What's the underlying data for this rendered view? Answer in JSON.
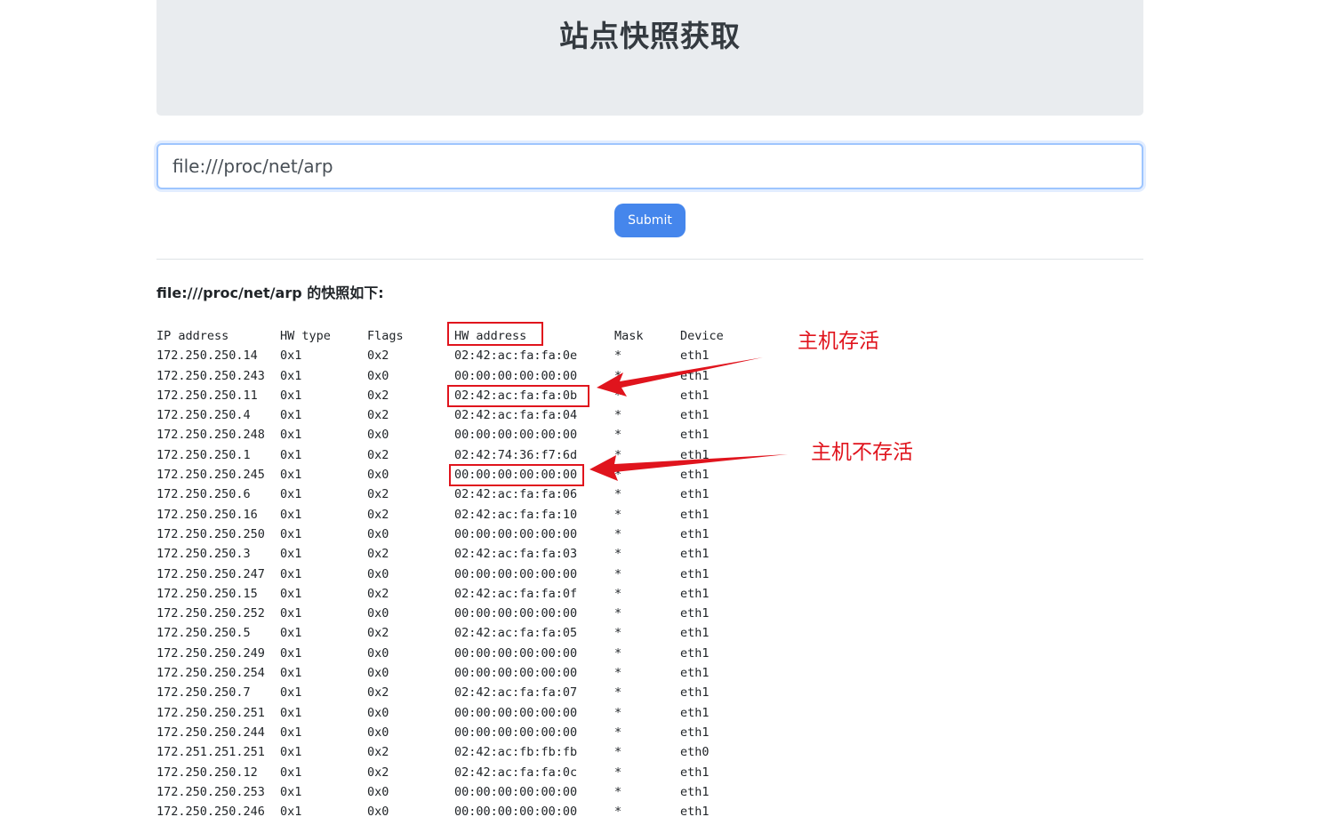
{
  "header": {
    "title": "站点快照获取"
  },
  "form": {
    "url_value": "file:///proc/net/arp",
    "submit_label": "Submit"
  },
  "result": {
    "heading": "file:///proc/net/arp 的快照如下:",
    "columns": [
      "IP address",
      "HW type",
      "Flags",
      "HW address",
      "Mask",
      "Device"
    ],
    "rows": [
      [
        "172.250.250.14",
        "0x1",
        "0x2",
        "02:42:ac:fa:fa:0e",
        "*",
        "eth1"
      ],
      [
        "172.250.250.243",
        "0x1",
        "0x0",
        "00:00:00:00:00:00",
        "*",
        "eth1"
      ],
      [
        "172.250.250.11",
        "0x1",
        "0x2",
        "02:42:ac:fa:fa:0b",
        "*",
        "eth1"
      ],
      [
        "172.250.250.4",
        "0x1",
        "0x2",
        "02:42:ac:fa:fa:04",
        "*",
        "eth1"
      ],
      [
        "172.250.250.248",
        "0x1",
        "0x0",
        "00:00:00:00:00:00",
        "*",
        "eth1"
      ],
      [
        "172.250.250.1",
        "0x1",
        "0x2",
        "02:42:74:36:f7:6d",
        "*",
        "eth1"
      ],
      [
        "172.250.250.245",
        "0x1",
        "0x0",
        "00:00:00:00:00:00",
        "*",
        "eth1"
      ],
      [
        "172.250.250.6",
        "0x1",
        "0x2",
        "02:42:ac:fa:fa:06",
        "*",
        "eth1"
      ],
      [
        "172.250.250.16",
        "0x1",
        "0x2",
        "02:42:ac:fa:fa:10",
        "*",
        "eth1"
      ],
      [
        "172.250.250.250",
        "0x1",
        "0x0",
        "00:00:00:00:00:00",
        "*",
        "eth1"
      ],
      [
        "172.250.250.3",
        "0x1",
        "0x2",
        "02:42:ac:fa:fa:03",
        "*",
        "eth1"
      ],
      [
        "172.250.250.247",
        "0x1",
        "0x0",
        "00:00:00:00:00:00",
        "*",
        "eth1"
      ],
      [
        "172.250.250.15",
        "0x1",
        "0x2",
        "02:42:ac:fa:fa:0f",
        "*",
        "eth1"
      ],
      [
        "172.250.250.252",
        "0x1",
        "0x0",
        "00:00:00:00:00:00",
        "*",
        "eth1"
      ],
      [
        "172.250.250.5",
        "0x1",
        "0x2",
        "02:42:ac:fa:fa:05",
        "*",
        "eth1"
      ],
      [
        "172.250.250.249",
        "0x1",
        "0x0",
        "00:00:00:00:00:00",
        "*",
        "eth1"
      ],
      [
        "172.250.250.254",
        "0x1",
        "0x0",
        "00:00:00:00:00:00",
        "*",
        "eth1"
      ],
      [
        "172.250.250.7",
        "0x1",
        "0x2",
        "02:42:ac:fa:fa:07",
        "*",
        "eth1"
      ],
      [
        "172.250.250.251",
        "0x1",
        "0x0",
        "00:00:00:00:00:00",
        "*",
        "eth1"
      ],
      [
        "172.250.250.244",
        "0x1",
        "0x0",
        "00:00:00:00:00:00",
        "*",
        "eth1"
      ],
      [
        "172.251.251.251",
        "0x1",
        "0x2",
        "02:42:ac:fb:fb:fb",
        "*",
        "eth0"
      ],
      [
        "172.250.250.12",
        "0x1",
        "0x2",
        "02:42:ac:fa:fa:0c",
        "*",
        "eth1"
      ],
      [
        "172.250.250.253",
        "0x1",
        "0x0",
        "00:00:00:00:00:00",
        "*",
        "eth1"
      ],
      [
        "172.250.250.246",
        "0x1",
        "0x0",
        "00:00:00:00:00:00",
        "*",
        "eth1"
      ]
    ]
  },
  "annotations": {
    "alive_label": "主机存活",
    "dead_label": "主机不存活",
    "color": "#e0141d"
  },
  "colors": {
    "jumbotron_bg": "#e9ecef",
    "button_bg": "#4586ec",
    "input_border": "#9ec5fe"
  }
}
